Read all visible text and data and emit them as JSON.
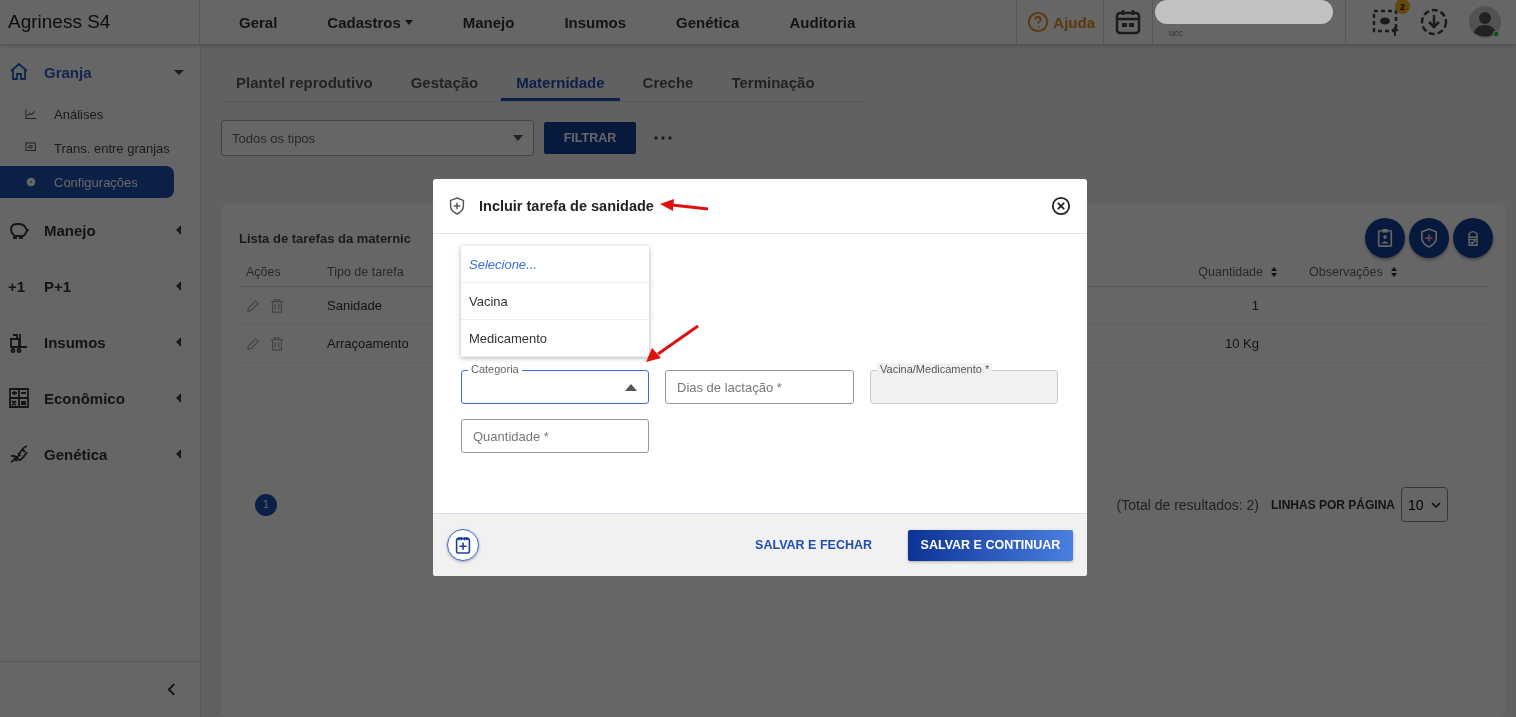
{
  "app": {
    "logo": "Agriness S4"
  },
  "top_nav": [
    {
      "label": "Geral",
      "dropdown": false
    },
    {
      "label": "Cadastros",
      "dropdown": true
    },
    {
      "label": "Manejo",
      "dropdown": false
    },
    {
      "label": "Insumos",
      "dropdown": false
    },
    {
      "label": "Genética",
      "dropdown": false
    },
    {
      "label": "Auditoria",
      "dropdown": false
    }
  ],
  "header": {
    "help": "Ajuda",
    "account_caption": "ucc",
    "notification_count": "2"
  },
  "sidebar": {
    "items": [
      {
        "label": "Granja",
        "expanded": true,
        "children": [
          {
            "label": "Análises",
            "selected": false
          },
          {
            "label": "Trans. entre granjas",
            "selected": false
          },
          {
            "label": "Configurações",
            "selected": true
          }
        ]
      },
      {
        "label": "Manejo",
        "expanded": false
      },
      {
        "label": "P+1",
        "icon_text": "+1",
        "expanded": false
      },
      {
        "label": "Insumos",
        "expanded": false
      },
      {
        "label": "Econômico",
        "expanded": false
      },
      {
        "label": "Genética",
        "expanded": false
      }
    ]
  },
  "tabs": [
    {
      "label": "Plantel reprodutivo",
      "selected": false
    },
    {
      "label": "Gestação",
      "selected": false
    },
    {
      "label": "Maternidade",
      "selected": true
    },
    {
      "label": "Creche",
      "selected": false
    },
    {
      "label": "Terminação",
      "selected": false
    }
  ],
  "filter": {
    "type_select": "Todos os tipos",
    "button": "FILTRAR"
  },
  "list": {
    "title": "Lista de tarefas da maternic",
    "columns": [
      {
        "label": "Ações",
        "sortable": false
      },
      {
        "label": "Tipo de tarefa",
        "sortable": false
      },
      {
        "label": "Quantidade",
        "sortable": true
      },
      {
        "label": "Observações",
        "sortable": true
      }
    ],
    "rows": [
      {
        "type": "Sanidade",
        "quantity": "1"
      },
      {
        "type": "Arraçoamento",
        "quantity": "10 Kg"
      }
    ],
    "page": "1",
    "total": "(Total de resultados: 2)",
    "rows_per_page_label": "LINHAS POR PÁGINA",
    "rows_per_page": "10"
  },
  "modal": {
    "title": "Incluir tarefa de sanidade",
    "options": [
      {
        "label": "Selecione...",
        "kind": "placeholder"
      },
      {
        "label": "Vacina",
        "kind": "option"
      },
      {
        "label": "Medicamento",
        "kind": "option"
      }
    ],
    "fields": [
      {
        "kind": "select",
        "label": "Categoria",
        "focused": true,
        "disabled": false
      },
      {
        "kind": "input",
        "placeholder": "Dias de lactação *",
        "focused": false,
        "disabled": false
      },
      {
        "kind": "input",
        "label": "Vacina/Medicamento *",
        "focused": false,
        "disabled": true
      },
      {
        "kind": "input",
        "placeholder": "Quantidade *",
        "focused": false,
        "disabled": false
      }
    ],
    "secondary_button": "SALVAR E FECHAR",
    "primary_button": "SALVAR E CONTINUAR"
  }
}
